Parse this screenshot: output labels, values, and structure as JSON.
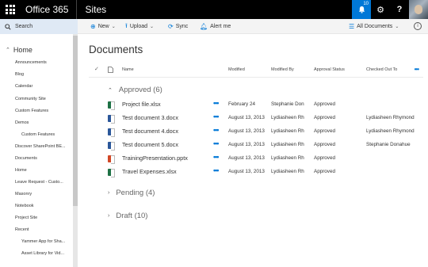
{
  "suite": {
    "brand": "Office 365",
    "site": "Sites",
    "notification_count": "10"
  },
  "commands": {
    "search": "Search",
    "new": "New",
    "upload": "Upload",
    "sync": "Sync",
    "alert": "Alert me",
    "view": "All Documents"
  },
  "nav": {
    "home": "Home",
    "items": [
      "Announcements",
      "Blog",
      "Calendar",
      "Community Site",
      "Custom Features",
      "Demos",
      "Custom Features",
      "Discover SharePoint BE...",
      "Documents",
      "Home",
      "Leave Request - Custo...",
      "Masonry",
      "Notebook",
      "Project Site",
      "Recent",
      "Yammer App for Sha...",
      "Asset Library for Vid..."
    ]
  },
  "library": {
    "title": "Documents",
    "columns": {
      "name": "Name",
      "modified": "Modified",
      "modified_by": "Modified By",
      "approval_status": "Approval Status",
      "checked_out_to": "Checked Out To"
    },
    "groups": {
      "approved": "Approved (6)",
      "pending": "Pending (4)",
      "draft": "Draft (10)"
    },
    "rows": [
      {
        "type": "xlsx",
        "name": "Project file.xlsx",
        "modified": "February 24",
        "modified_by": "Stephanie Dona...",
        "status": "Approved",
        "checked_out_to": ""
      },
      {
        "type": "docx",
        "name": "Test document 3.docx",
        "modified": "August 13, 2013",
        "modified_by": "Lydiasheen Rh...",
        "status": "Approved",
        "checked_out_to": "Lydiasheen Rhymond"
      },
      {
        "type": "docx",
        "name": "Test document 4.docx",
        "modified": "August 13, 2013",
        "modified_by": "Lydiasheen Rh...",
        "status": "Approved",
        "checked_out_to": "Lydiasheen Rhymond"
      },
      {
        "type": "docx",
        "name": "Test document 5.docx",
        "modified": "August 13, 2013",
        "modified_by": "Lydiasheen Rh...",
        "status": "Approved",
        "checked_out_to": "Stephanie Donahue"
      },
      {
        "type": "pptx",
        "name": "TrainingPresentation.pptx",
        "modified": "August 13, 2013",
        "modified_by": "Lydiasheen Rh...",
        "status": "Approved",
        "checked_out_to": ""
      },
      {
        "type": "xlsx",
        "name": "Travel Expenses.xlsx",
        "modified": "August 13, 2013",
        "modified_by": "Lydiasheen Rh...",
        "status": "Approved",
        "checked_out_to": ""
      }
    ]
  }
}
